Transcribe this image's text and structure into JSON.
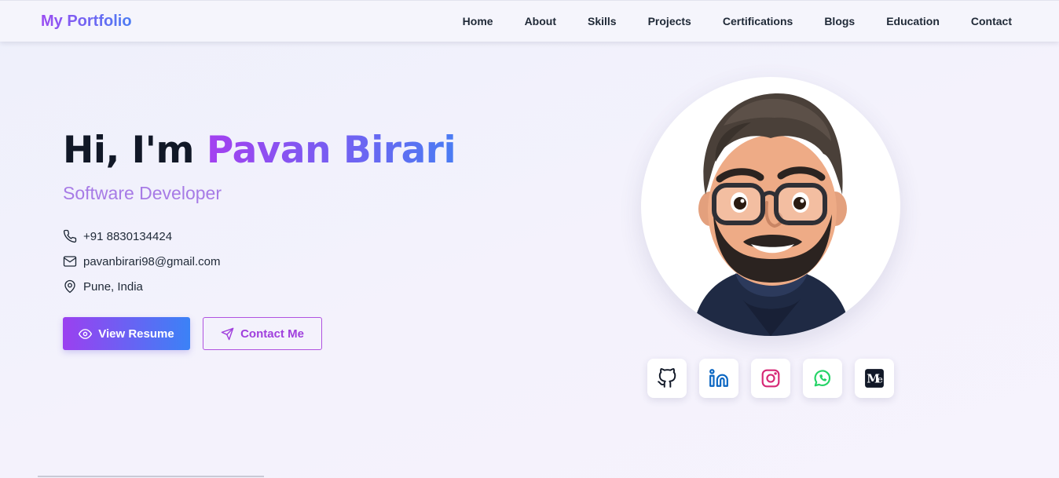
{
  "brand": "My Portfolio",
  "nav": [
    "Home",
    "About",
    "Skills",
    "Projects",
    "Certifications",
    "Blogs",
    "Education",
    "Contact"
  ],
  "hero": {
    "greeting": "Hi, I'm ",
    "name": "Pavan Birari",
    "role": "Software Developer",
    "phone": "+91 8830134424",
    "email": "pavanbirari98@gmail.com",
    "location": "Pune, India",
    "primary_button": "View Resume",
    "secondary_button": "Contact Me"
  },
  "social": [
    {
      "icon": "github-icon"
    },
    {
      "icon": "linkedin-icon"
    },
    {
      "icon": "instagram-icon"
    },
    {
      "icon": "whatsapp-icon"
    },
    {
      "icon": "medium-icon"
    }
  ],
  "colors": {
    "accent_purple": "#9b40f0",
    "accent_blue": "#3b82f6",
    "role_text": "#a77be6",
    "linkedin": "#0a66c2",
    "instagram": "#d62976",
    "whatsapp": "#25d366"
  }
}
